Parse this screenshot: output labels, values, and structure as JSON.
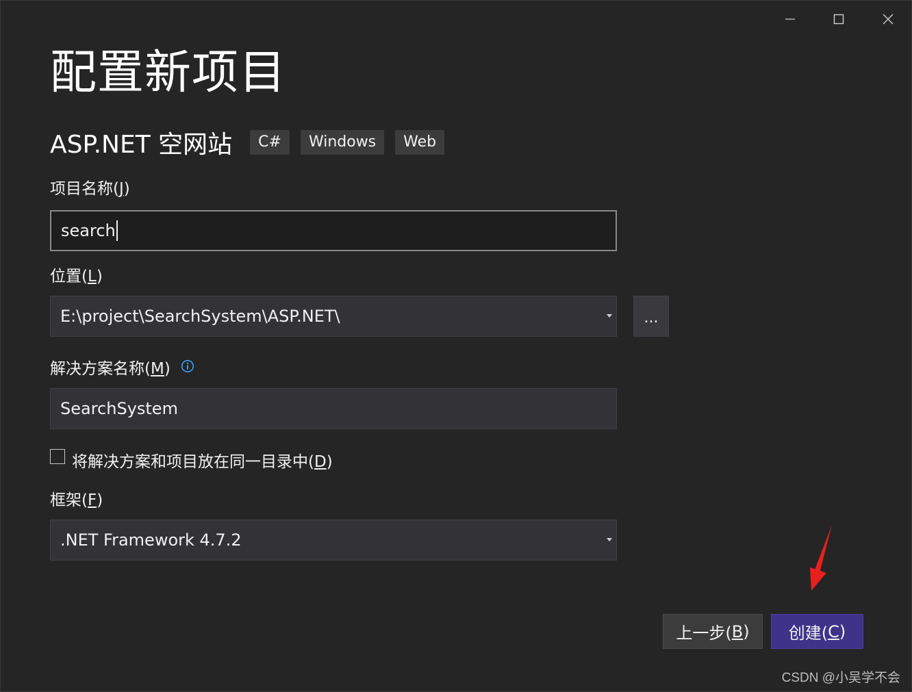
{
  "window": {
    "title": "配置新项目",
    "controls": [
      "minimize-icon",
      "maximize-icon",
      "close-icon"
    ]
  },
  "template": {
    "name": "ASP.NET 空网站",
    "tags": [
      "C#",
      "Windows",
      "Web"
    ]
  },
  "fields": {
    "project_name": {
      "label": "项目名称(J)",
      "label_prefix": "项目名称(",
      "label_key": "J",
      "label_suffix": ")",
      "value": "search"
    },
    "location": {
      "label_prefix": "位置(",
      "label_key": "L",
      "label_suffix": ")",
      "value": "E:\\project\\SearchSystem\\ASP.NET\\",
      "browse_label": "..."
    },
    "solution_name": {
      "label_prefix": "解决方案名称(",
      "label_key": "M",
      "label_suffix": ")",
      "value": "SearchSystem",
      "info_icon": "info-icon"
    },
    "same_dir": {
      "label_prefix": "将解决方案和项目放在同一目录中(",
      "label_key": "D",
      "label_suffix": ")",
      "checked": false
    },
    "framework": {
      "label_prefix": "框架(",
      "label_key": "F",
      "label_suffix": ")",
      "value": ".NET Framework 4.7.2"
    }
  },
  "buttons": {
    "back_prefix": "上一步(",
    "back_key": "B",
    "back_suffix": ")",
    "create_prefix": "创建(",
    "create_key": "C",
    "create_suffix": ")"
  },
  "colors": {
    "background": "#252526",
    "create_button": "#3e3289",
    "annotation_arrow": "#e8201c",
    "info_icon": "#3aa0f3"
  },
  "watermark": "CSDN @小吴学不会"
}
